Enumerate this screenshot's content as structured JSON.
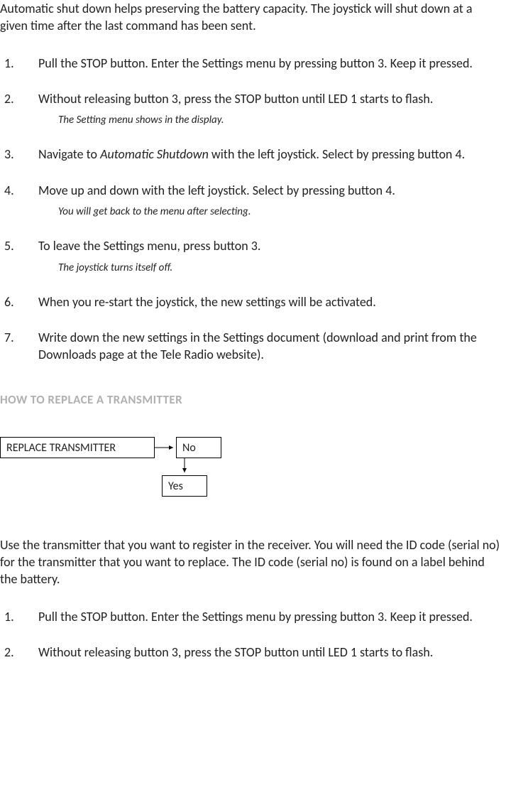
{
  "intro1": "Automatic shut down helps preserving the battery capacity. The joystick will shut down at a given time after the last command has been sent.",
  "list1": {
    "n1": "1.",
    "s1": "Pull the STOP button. Enter the Settings menu by pressing button 3. Keep it pressed.",
    "n2": "2.",
    "s2": "Without releasing button 3, press the STOP button until LED 1 starts to flash.",
    "s2note": "The Setting menu shows in the display.",
    "n3": "3.",
    "s3a": "Navigate to ",
    "s3term": "Automatic Shutdown",
    "s3b": " with the left joystick. Select by pressing button 4.",
    "n4": "4.",
    "s4": "Move up and down with the left joystick. Select by pressing button 4.",
    "s4note": "You will get back to the menu after selecting.",
    "n5": "5.",
    "s5": "To leave the Settings menu, press button 3.",
    "s5note": "The joystick turns itself off.",
    "n6": "6.",
    "s6": "When you re-start the joystick, the new settings will be activated.",
    "n7": "7.",
    "s7": "Write down the new settings in the Settings document (download and print from the Downloads page at the Tele Radio website)."
  },
  "section_heading": "HOW TO REPLACE A TRANSMITTER",
  "diagram": {
    "replace": "REPLACE TRANSMITTER",
    "no": "No",
    "yes": "Yes"
  },
  "intro2": "Use the transmitter that you want to register in the receiver. You will need the ID code (serial no) for the transmitter that you want to replace. The ID code (serial no) is found on a label behind the battery.",
  "list2": {
    "n1": "1.",
    "s1": "Pull the STOP button. Enter the Settings menu by pressing button 3. Keep it pressed.",
    "n2": "2.",
    "s2": "Without releasing button 3, press the STOP button until LED 1 starts to flash."
  }
}
